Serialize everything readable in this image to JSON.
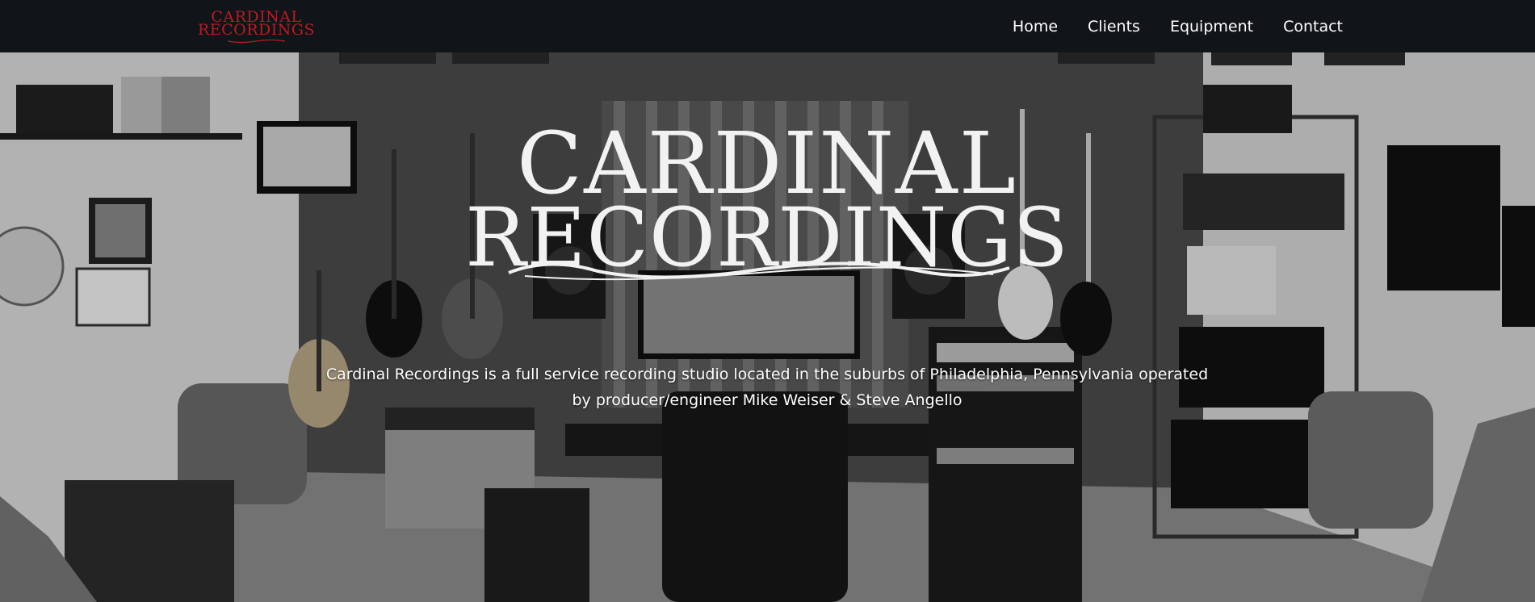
{
  "brand": {
    "line1": "CARDINAL",
    "line2": "RECORDINGS",
    "color": "#b81c22"
  },
  "nav": {
    "items": [
      {
        "label": "Home"
      },
      {
        "label": "Clients"
      },
      {
        "label": "Equipment"
      },
      {
        "label": "Contact"
      }
    ]
  },
  "hero": {
    "logo_line1": "CARDINAL",
    "logo_line2": "RECORDINGS",
    "description": "Cardinal Recordings is a full service recording studio located in the suburbs of Philadelphia, Pennsylvania operated by producer/engineer Mike Weiser & Steve Angello"
  }
}
